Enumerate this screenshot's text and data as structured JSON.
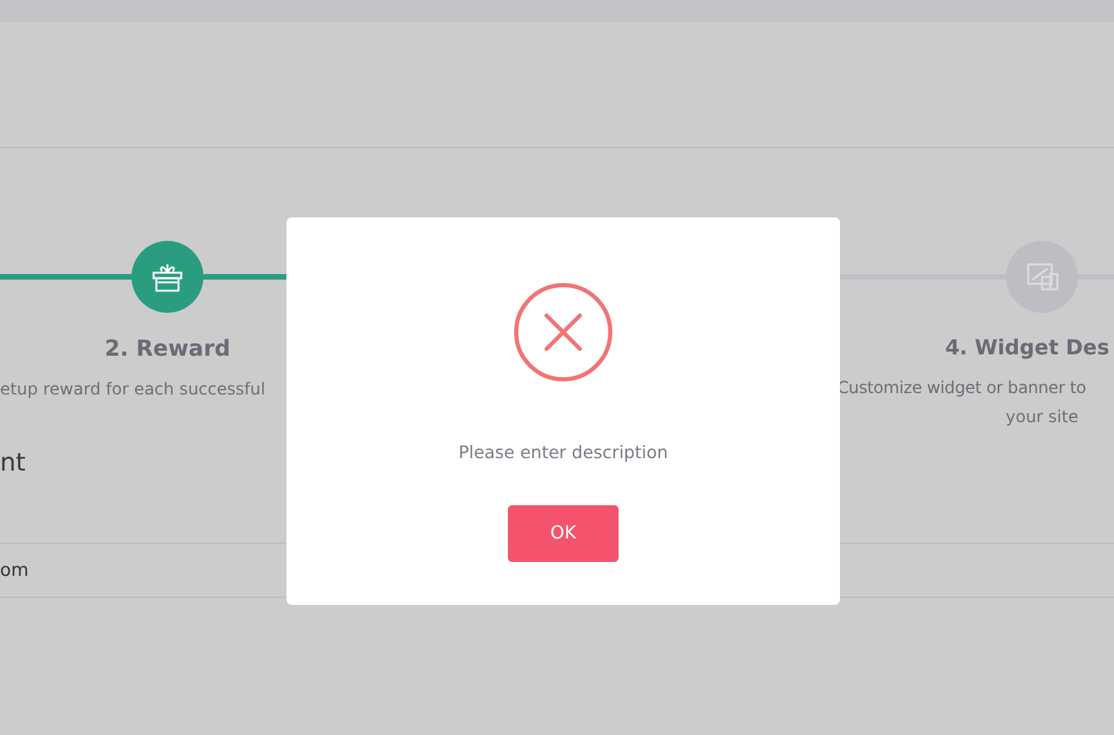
{
  "steps": [
    {
      "kind": "reward",
      "title": "2. Reward",
      "done": true,
      "description_lines": [
        "etup reward for each successful"
      ]
    },
    {
      "kind": "widget",
      "title": "4. Widget Des",
      "done": false,
      "description_lines": [
        "Customize widget or banner to",
        "your site"
      ]
    }
  ],
  "section_heading": "nt",
  "table_rows": [
    "om"
  ],
  "dialog": {
    "message": "Please enter description",
    "button": "OK"
  }
}
